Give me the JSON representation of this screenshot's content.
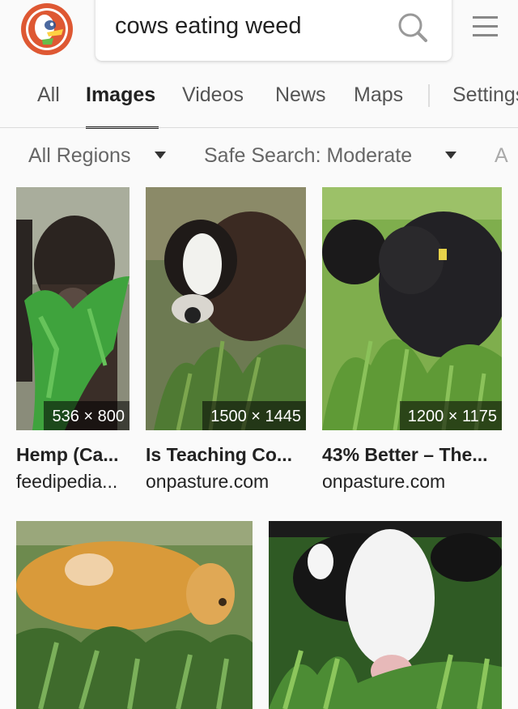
{
  "search": {
    "query": "cows eating weed"
  },
  "tabs": [
    {
      "label": "All"
    },
    {
      "label": "Images"
    },
    {
      "label": "Videos"
    },
    {
      "label": "News"
    },
    {
      "label": "Maps"
    },
    {
      "label": "Settings"
    }
  ],
  "active_tab": "Images",
  "filters": {
    "region_label": "All Regions",
    "safe_search_label": "Safe Search: Moderate",
    "overflow_label": "A"
  },
  "results": [
    {
      "dimensions": "536 × 800",
      "title": "Hemp (Ca...",
      "domain": "feedipedia..."
    },
    {
      "dimensions": "1500 × 1445",
      "title": "Is Teaching Co...",
      "domain": "onpasture.com"
    },
    {
      "dimensions": "1200 × 1175",
      "title": "43% Better – The...",
      "domain": "onpasture.com"
    },
    {
      "dimensions": "",
      "title": "",
      "domain": ""
    },
    {
      "dimensions": "",
      "title": "",
      "domain": ""
    }
  ],
  "colors": {
    "brand_orange": "#de5833",
    "active_text": "#222222",
    "muted_text": "#666666"
  }
}
